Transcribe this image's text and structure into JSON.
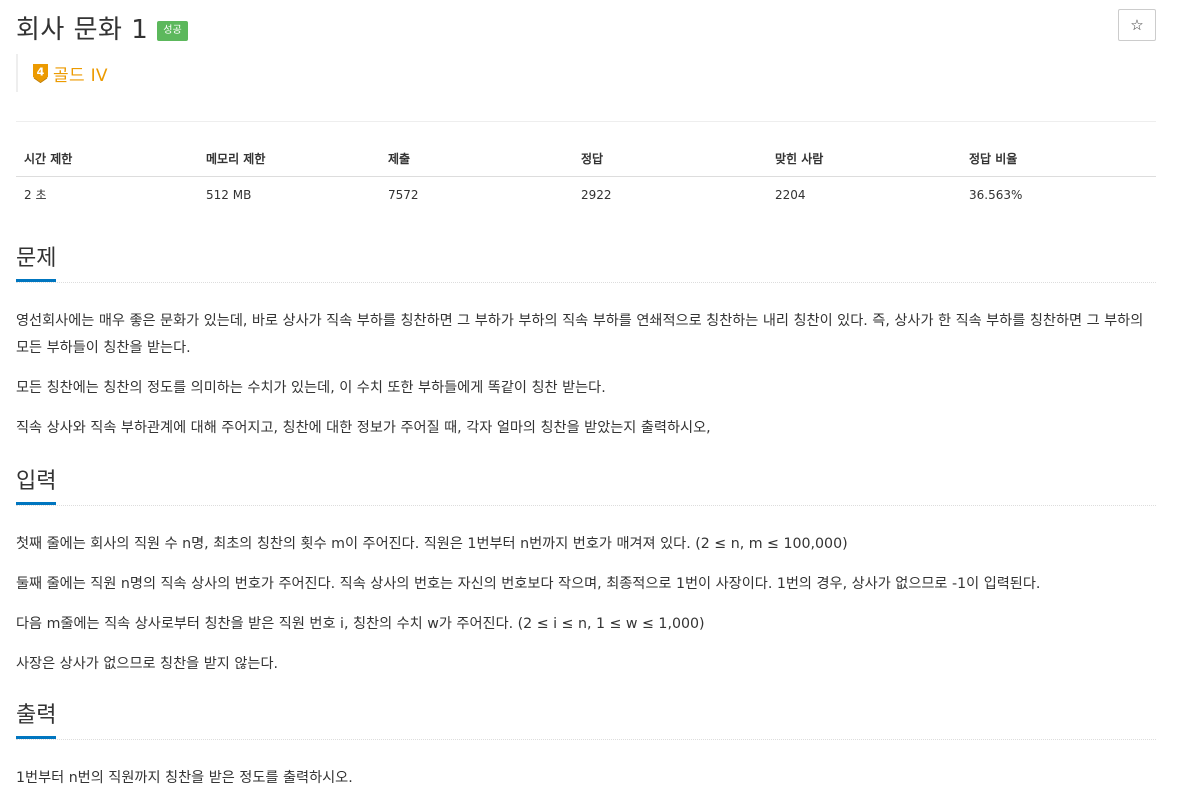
{
  "problem": {
    "title": "회사 문화 1",
    "badge": "성공",
    "star_icon": "☆",
    "tier": {
      "number": "4",
      "label": "골드 IV",
      "color": "#ec9a00"
    }
  },
  "info_table": {
    "headers": [
      "시간 제한",
      "메모리 제한",
      "제출",
      "정답",
      "맞힌 사람",
      "정답 비율"
    ],
    "values": [
      "2 초",
      "512 MB",
      "7572",
      "2922",
      "2204",
      "36.563%"
    ]
  },
  "sections": {
    "problem": {
      "title": "문제",
      "paragraphs": [
        "영선회사에는 매우 좋은 문화가 있는데, 바로 상사가 직속 부하를 칭찬하면 그 부하가 부하의 직속 부하를 연쇄적으로 칭찬하는 내리 칭찬이 있다. 즉, 상사가 한 직속 부하를 칭찬하면 그 부하의 모든 부하들이 칭찬을 받는다.",
        "모든 칭찬에는 칭찬의 정도를 의미하는 수치가 있는데, 이 수치 또한 부하들에게 똑같이 칭찬 받는다.",
        "직속 상사와 직속 부하관계에 대해 주어지고, 칭찬에 대한 정보가 주어질 때, 각자 얼마의 칭찬을 받았는지 출력하시오,"
      ]
    },
    "input": {
      "title": "입력",
      "paragraphs": [
        "첫째 줄에는 회사의 직원 수 n명, 최초의 칭찬의 횟수 m이 주어진다. 직원은 1번부터 n번까지 번호가 매겨져 있다. (2 ≤ n, m ≤ 100,000)",
        "둘째 줄에는 직원 n명의 직속 상사의 번호가 주어진다. 직속 상사의 번호는 자신의 번호보다 작으며, 최종적으로 1번이 사장이다. 1번의 경우, 상사가 없으므로 -1이 입력된다.",
        "다음 m줄에는 직속 상사로부터 칭찬을 받은 직원 번호 i, 칭찬의 수치 w가 주어진다. (2 ≤ i ≤ n, 1 ≤ w ≤ 1,000)",
        "사장은 상사가 없으므로 칭찬을 받지 않는다."
      ]
    },
    "output": {
      "title": "출력",
      "paragraphs": [
        "1번부터 n번의 직원까지 칭찬을 받은 정도를 출력하시오."
      ]
    }
  },
  "colors": {
    "accent": "#0076c0",
    "success": "#5cb85c",
    "gold": "#ec9a00"
  }
}
